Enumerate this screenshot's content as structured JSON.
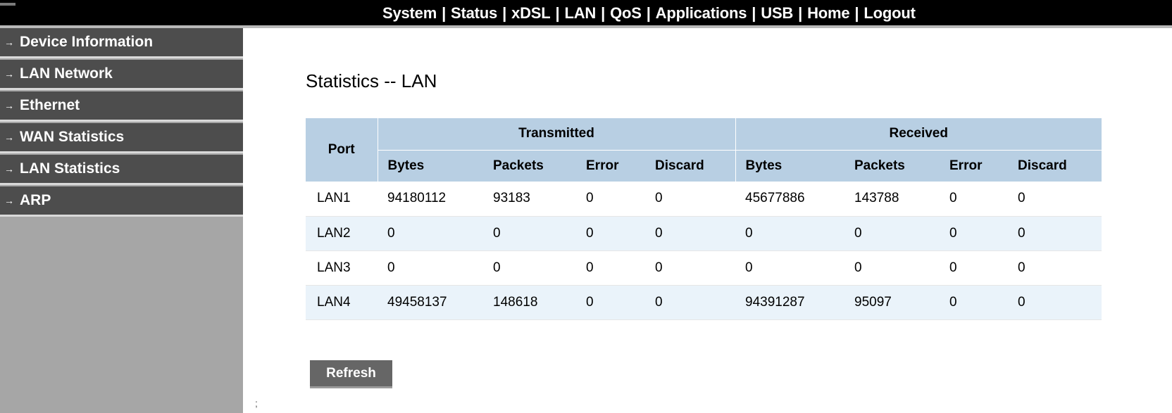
{
  "topnav": {
    "items": [
      "System",
      "Status",
      "xDSL",
      "LAN",
      "QoS",
      "Applications",
      "USB",
      "Home",
      "Logout"
    ],
    "separator": "|"
  },
  "sidebar": {
    "arrow": "→",
    "items": [
      {
        "label": "Device Information"
      },
      {
        "label": "LAN Network"
      },
      {
        "label": "Ethernet"
      },
      {
        "label": "WAN Statistics"
      },
      {
        "label": "LAN Statistics"
      },
      {
        "label": "ARP"
      }
    ]
  },
  "main": {
    "title": "Statistics -- LAN",
    "table": {
      "port_header": "Port",
      "group_transmitted": "Transmitted",
      "group_received": "Received",
      "sub_headers": [
        "Bytes",
        "Packets",
        "Error",
        "Discard",
        "Bytes",
        "Packets",
        "Error",
        "Discard"
      ],
      "rows": [
        [
          "LAN1",
          "94180112",
          "93183",
          "0",
          "0",
          "45677886",
          "143788",
          "0",
          "0"
        ],
        [
          "LAN2",
          "0",
          "0",
          "0",
          "0",
          "0",
          "0",
          "0",
          "0"
        ],
        [
          "LAN3",
          "0",
          "0",
          "0",
          "0",
          "0",
          "0",
          "0",
          "0"
        ],
        [
          "LAN4",
          "49458137",
          "148618",
          "0",
          "0",
          "94391287",
          "95097",
          "0",
          "0"
        ]
      ]
    },
    "refresh_label": "Refresh",
    "stray_mark": ";"
  },
  "colors": {
    "topbar": "#000000",
    "sidebar_item": "#4d4d4d",
    "sidebar_bg": "#a6a6a6",
    "table_header": "#b8cfe3",
    "row_alt": "#eaf3fa",
    "button": "#666666"
  }
}
